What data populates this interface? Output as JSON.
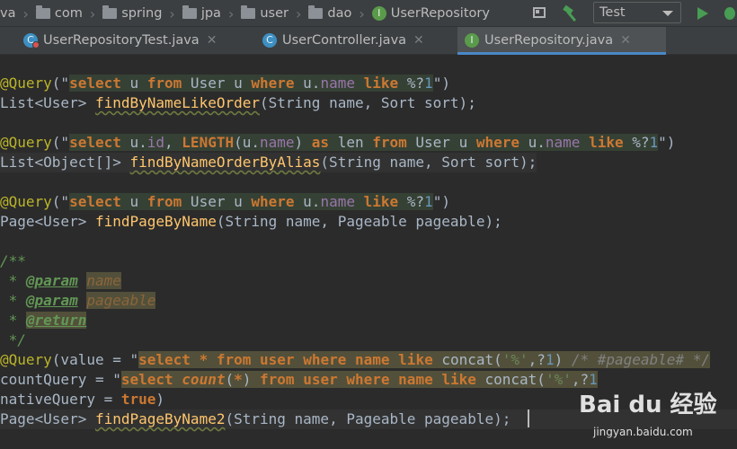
{
  "breadcrumbs": [
    "va",
    "com",
    "spring",
    "jpa",
    "user",
    "dao"
  ],
  "breadcrumb_file": "UserRepository",
  "run_config": "Test",
  "tabs": [
    {
      "label": "UserRepositoryTest.java",
      "active": false
    },
    {
      "label": "UserController.java",
      "active": false
    },
    {
      "label": "UserRepository.java",
      "active": true
    }
  ],
  "code": {
    "q1_prefix": "@Query(\"",
    "q1_suffix": "\")",
    "m1_type": "List<User> ",
    "m1_name": "findByNameLikeOrder",
    "m1_params": "(String name, Sort sort);",
    "q2_suffix": "\")",
    "m2_type": "List<Object[]> ",
    "m2_name": "findByNameOrderByAlias",
    "m2_params": "(String name, Sort sort);",
    "m3_type": "Page<User> ",
    "m3_name": "findPageByName",
    "m3_params": "(String name, Pageable pageable);",
    "doc_open": "/**",
    "doc_param_tag": "@param",
    "doc_param1": "name",
    "doc_param2": "pageable",
    "doc_return_tag": "@return",
    "doc_close": " */",
    "q4_value_prefix": "@Query(value = \"",
    "q4_comment": " /* #pageable# */",
    "q4_count_prefix": "countQuery = \"",
    "q4_native": "nativeQuery = true)",
    "m4_type": "Page<User> ",
    "m4_name": "findPageByName2",
    "m4_params": "(String name, Pageable pageable);"
  },
  "watermark": {
    "brand": "Bai du 经验",
    "url": "jingyan.baidu.com"
  }
}
